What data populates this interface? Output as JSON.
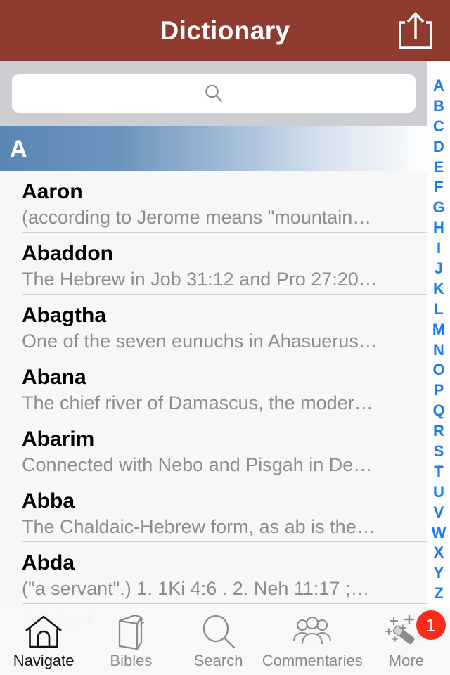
{
  "header": {
    "title": "Dictionary",
    "share_icon": "share-icon",
    "background_color": "#8f3a2f"
  },
  "search": {
    "value": "",
    "placeholder": "",
    "icon": "search-icon"
  },
  "section": {
    "label": "A"
  },
  "entries": [
    {
      "title": "Aaron",
      "description": "(according to Jerome means \"mountain…"
    },
    {
      "title": "Abaddon",
      "description": "The Hebrew in Job 31:12 and Pro 27:20…"
    },
    {
      "title": "Abagtha",
      "description": "One of the seven eunuchs in Ahasuerus…"
    },
    {
      "title": "Abana",
      "description": "The chief river of Damascus, the moder…"
    },
    {
      "title": "Abarim",
      "description": "Connected with Nebo and Pisgah in De…"
    },
    {
      "title": "Abba",
      "description": "The Chaldaic-Hebrew form, as ab is the…"
    },
    {
      "title": "Abda",
      "description": "(\"a servant\".) 1. 1Ki 4:6 . 2. Neh 11:17 ;…"
    }
  ],
  "partially_hidden_entry": "Abdeel",
  "index_bar": {
    "letters": [
      "A",
      "B",
      "C",
      "D",
      "E",
      "F",
      "G",
      "H",
      "I",
      "J",
      "K",
      "L",
      "M",
      "N",
      "O",
      "P",
      "Q",
      "R",
      "S",
      "T",
      "U",
      "V",
      "W",
      "X",
      "Y",
      "Z"
    ],
    "color": "#1a7ced"
  },
  "tabs": [
    {
      "label": "Navigate",
      "icon": "home-icon",
      "active": true,
      "badge": null
    },
    {
      "label": "Bibles",
      "icon": "book-icon",
      "active": false,
      "badge": null
    },
    {
      "label": "Search",
      "icon": "magnifier-icon",
      "active": false,
      "badge": null
    },
    {
      "label": "Commentaries",
      "icon": "people-group-icon",
      "active": false,
      "badge": null
    },
    {
      "label": "More",
      "icon": "magic-wand-icon",
      "active": false,
      "badge": "1"
    }
  ],
  "colors": {
    "navbar": "#8f3a2f",
    "section_gradient_start": "#5a86b4",
    "index_blue": "#1a7ced",
    "badge_red": "#fb2b1d",
    "list_background": "#f7f7f7"
  }
}
